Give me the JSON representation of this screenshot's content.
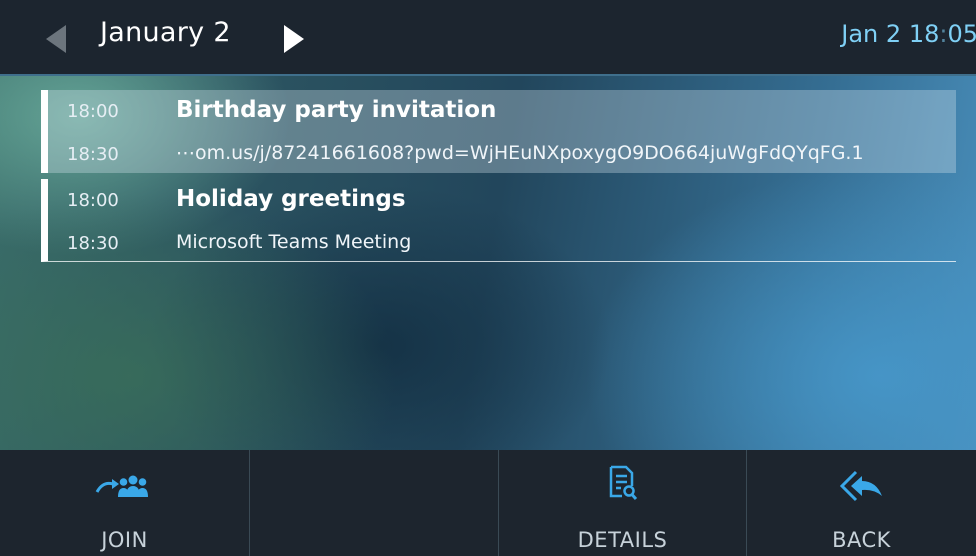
{
  "header": {
    "date_title": "January 2",
    "clock_date": "Jan 2",
    "clock_hour": "18",
    "clock_sep": ":",
    "clock_min": "05",
    "prev_icon": "left-triangle-icon",
    "next_icon": "right-triangle-icon"
  },
  "events": [
    {
      "start": "18:00",
      "end": "18:30",
      "title": "Birthday party invitation",
      "subtitle": "⋯om.us/j/87241661608?pwd=WjHEuNXpoxygO9DO664juWgFdQYqFG.1",
      "selected": true
    },
    {
      "start": "18:00",
      "end": "18:30",
      "title": "Holiday greetings",
      "subtitle": "Microsoft Teams Meeting",
      "selected": false
    }
  ],
  "softkeys": [
    {
      "label": "JOIN",
      "icon": "join-people-icon"
    },
    {
      "label": "",
      "icon": ""
    },
    {
      "label": "DETAILS",
      "icon": "details-document-search-icon"
    },
    {
      "label": "BACK",
      "icon": "back-arrow-icon"
    }
  ],
  "colors": {
    "header_bg": "#1c252f",
    "clock_text": "#7fd0f5",
    "accent_blue": "#3aa8e8",
    "softkey_bg": "#1d252e"
  }
}
